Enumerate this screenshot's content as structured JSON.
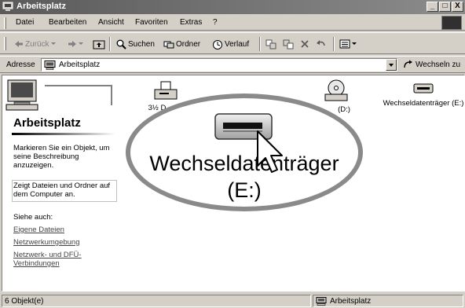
{
  "window": {
    "title": "Arbeitsplatz",
    "controls": [
      "_",
      "□",
      "X"
    ]
  },
  "menu": [
    "Datei",
    "Bearbeiten",
    "Ansicht",
    "Favoriten",
    "Extras",
    "?"
  ],
  "toolbar": {
    "back": "Zurück",
    "search": "Suchen",
    "folders": "Ordner",
    "history": "Verlauf"
  },
  "address": {
    "label": "Adresse",
    "value": "Arbeitsplatz",
    "go": "Wechseln zu"
  },
  "left_pane": {
    "title": "Arbeitsplatz",
    "description": "Markieren Sie ein Objekt, um seine Beschreibung anzuzeigen.",
    "info": "Zeigt Dateien und Ordner auf dem Computer an.",
    "see_also": "Siehe auch:",
    "links": [
      "Eigene Dateien",
      "Netzwerkumgebung",
      "Netzwerk- und DFÜ-Verbindungen"
    ]
  },
  "items": [
    {
      "label": "3½ D",
      "icon": "floppy-drive-icon"
    },
    {
      "label": "(D:)",
      "icon": "cd-drive-icon"
    },
    {
      "label": "Wechseldatenträger (E:)",
      "icon": "removable-drive-icon"
    }
  ],
  "magnified": {
    "line1": "Wechseldatenträger",
    "line2": "(E:)"
  },
  "status": {
    "objects": "6 Objekt(e)",
    "location": "Arbeitsplatz"
  }
}
